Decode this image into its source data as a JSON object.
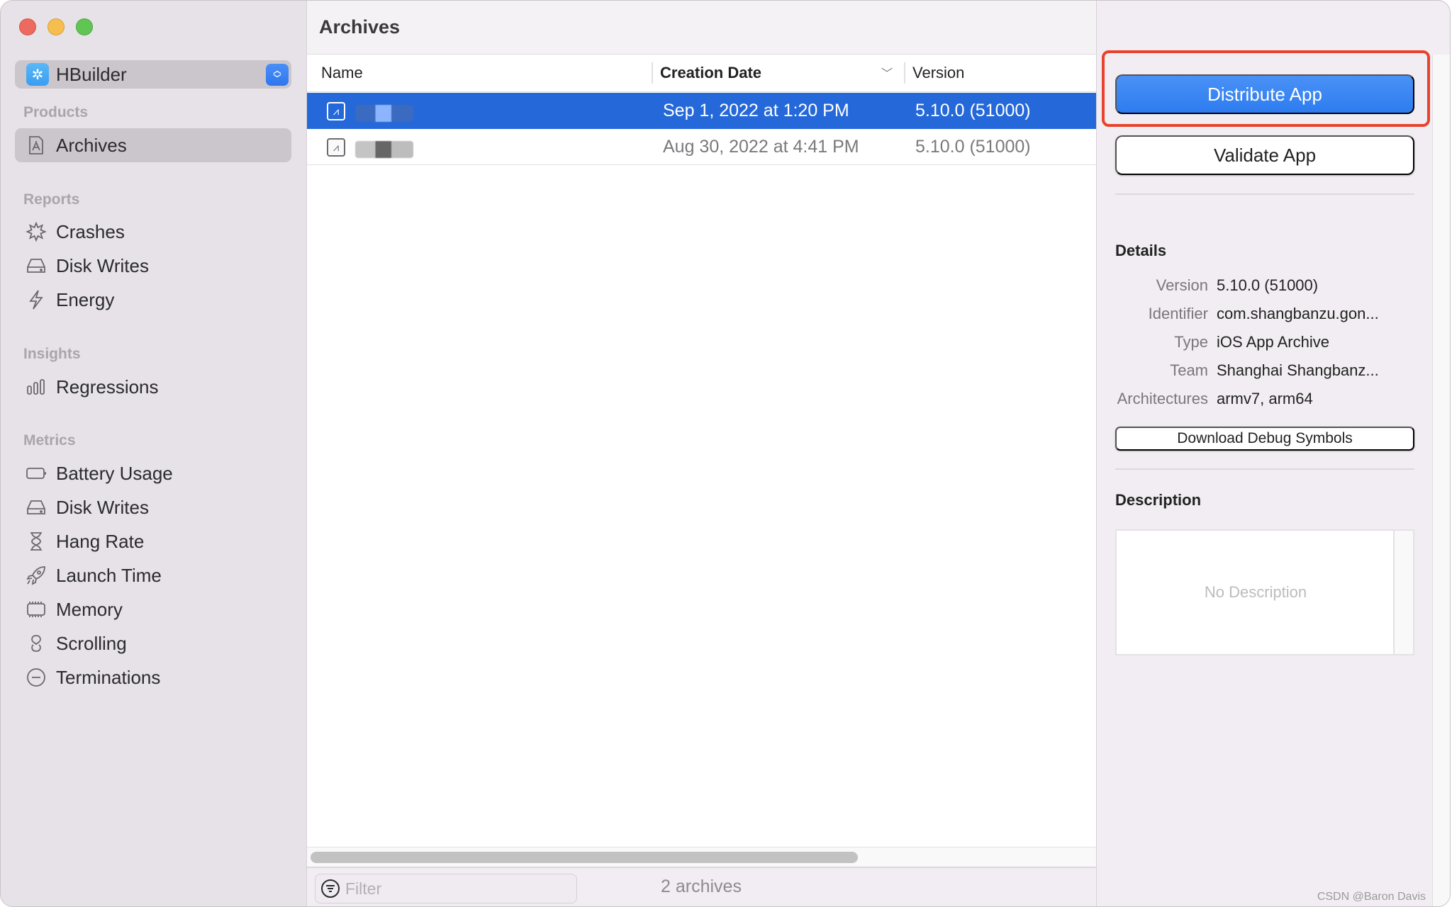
{
  "window": {
    "traffic_lights": [
      "close",
      "minimize",
      "zoom"
    ]
  },
  "sidebar": {
    "scheme_selector": {
      "label": "HBuilder",
      "icon": "hbuilder-app-icon"
    },
    "sections": [
      {
        "title": "Products",
        "items": [
          {
            "label": "Archives",
            "icon": "archive-icon",
            "selected": true
          }
        ]
      },
      {
        "title": "Reports",
        "items": [
          {
            "label": "Crashes",
            "icon": "crash-burst-icon"
          },
          {
            "label": "Disk Writes",
            "icon": "disk-drive-icon"
          },
          {
            "label": "Energy",
            "icon": "bolt-icon"
          }
        ]
      },
      {
        "title": "Insights",
        "items": [
          {
            "label": "Regressions",
            "icon": "bars-icon"
          }
        ]
      },
      {
        "title": "Metrics",
        "items": [
          {
            "label": "Battery Usage",
            "icon": "battery-icon"
          },
          {
            "label": "Disk Writes",
            "icon": "disk-drive-icon"
          },
          {
            "label": "Hang Rate",
            "icon": "hourglass-icon"
          },
          {
            "label": "Launch Time",
            "icon": "rocket-icon"
          },
          {
            "label": "Memory",
            "icon": "memory-chip-icon"
          },
          {
            "label": "Scrolling",
            "icon": "scroll-icon"
          },
          {
            "label": "Terminations",
            "icon": "minus-circle-icon"
          }
        ]
      }
    ]
  },
  "main": {
    "title": "Archives",
    "columns": [
      {
        "label": "Name"
      },
      {
        "label": "Creation Date",
        "sorted": true,
        "sort_direction": "descending"
      },
      {
        "label": "Version"
      }
    ],
    "rows": [
      {
        "name_redacted": true,
        "date": "Sep 1, 2022 at 1:20 PM",
        "version": "5.10.0 (51000)",
        "selected": true
      },
      {
        "name_redacted": true,
        "date": "Aug 30, 2022 at 4:41 PM",
        "version": "5.10.0 (51000)",
        "selected": false
      }
    ],
    "hscroll_visible_fraction": 0.7,
    "filter": {
      "placeholder": "Filter",
      "value": ""
    },
    "count_label": "2 archives"
  },
  "inspector": {
    "distribute_label": "Distribute App",
    "validate_label": "Validate App",
    "details_heading": "Details",
    "details": [
      {
        "key": "Version",
        "value": "5.10.0 (51000)"
      },
      {
        "key": "Identifier",
        "value": "com.shangbanzu.gon..."
      },
      {
        "key": "Type",
        "value": "iOS App Archive"
      },
      {
        "key": "Team",
        "value": "Shanghai Shangbanz..."
      },
      {
        "key": "Architectures",
        "value": "armv7, arm64"
      }
    ],
    "download_symbols_label": "Download Debug Symbols",
    "description_heading": "Description",
    "description_placeholder": "No Description"
  },
  "annotation": {
    "highlight_color": "#e8432e"
  },
  "colors": {
    "accent": "#2d7cf0",
    "selection": "#2468d9"
  },
  "watermark": "CSDN @Baron Davis"
}
